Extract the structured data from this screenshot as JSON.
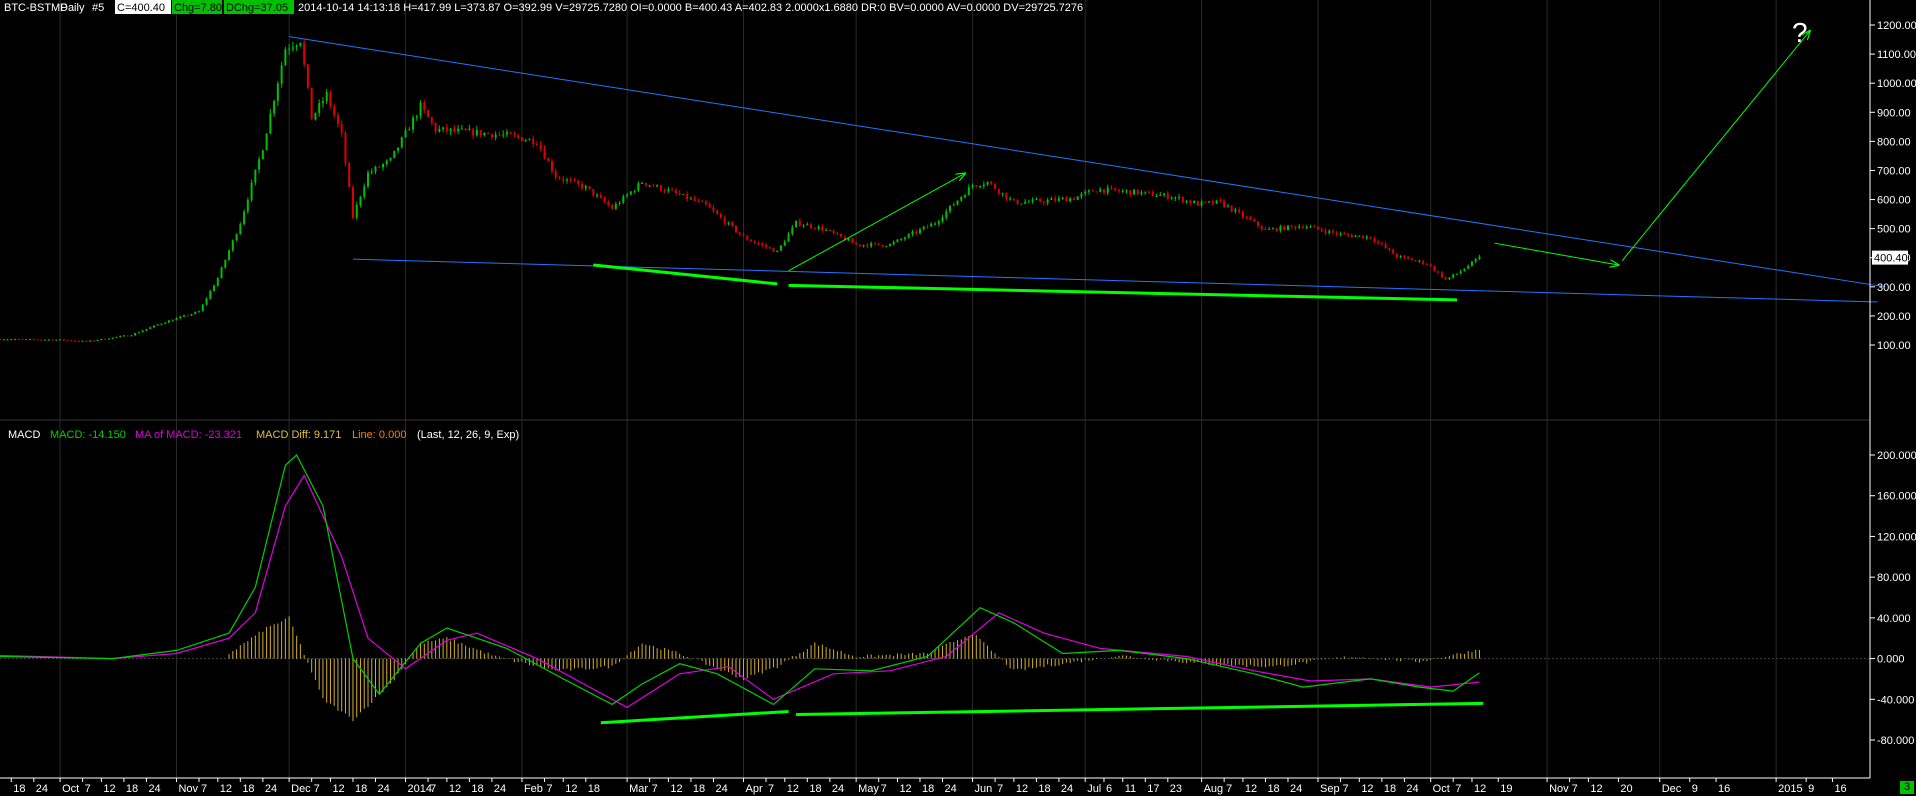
{
  "header": {
    "symbol": "BTC-BSTMP",
    "interval": "Daily",
    "index": "#5",
    "close_box": "C=400.40",
    "chg_box": "Chg=7.80",
    "dchg_box": "DChg=37.05",
    "stats": "2014-10-14 14:13:18 H=417.99 L=373.87 O=392.99 V=29725.7280 OI=0.0000 B=400.43 A=402.83 2.0000x1.6880 DR:0 BV=0.0000 AV=0.0000 DV=29725.7276"
  },
  "macd_header": {
    "label": "MACD",
    "macd": "MACD: -14.150",
    "ma": "MA of MACD: -23.321",
    "diff": "MACD Diff: 9.171",
    "line": "Line: 0.000",
    "params": "(Last, 12, 26, 9, Exp)"
  },
  "annotation": {
    "question_mark": "?"
  },
  "corner_badge": "3",
  "colors": {
    "background": "#000000",
    "up_candle": "#00c000",
    "down_candle": "#e00000",
    "trendline": "#1e78ff",
    "annotation": "#00ff00",
    "macd_line": "#00d000",
    "signal_line": "#e000e0",
    "histogram": "#d4b020",
    "grid": "#2a2a2a",
    "axis_text": "#ffffff",
    "last_price_box": "#ffffff"
  },
  "chart_data": [
    {
      "type": "candlestick",
      "name": "BTC-BSTMP",
      "last_price_label": "400.40",
      "y_axis": {
        "ticks": [
          "1200.00",
          "1100.00",
          "1000.00",
          "900.00",
          "800.00",
          "700.00",
          "600.00",
          "500.00",
          "400.00",
          "300.00",
          "200.00",
          "100.00"
        ],
        "tick_values": [
          1200,
          1100,
          1000,
          900,
          800,
          700,
          600,
          500,
          400,
          300,
          200,
          100
        ],
        "range": [
          80,
          1240
        ]
      },
      "price_path": [
        [
          "2013-09-15",
          120
        ],
        [
          "2013-10-01",
          118
        ],
        [
          "2013-10-08",
          112
        ],
        [
          "2013-10-20",
          135
        ],
        [
          "2013-10-28",
          175
        ],
        [
          "2013-11-07",
          215
        ],
        [
          "2013-11-12",
          330
        ],
        [
          "2013-11-18",
          520
        ],
        [
          "2013-11-24",
          780
        ],
        [
          "2013-11-30",
          1120
        ],
        [
          "2013-12-04",
          1150
        ],
        [
          "2013-12-07",
          880
        ],
        [
          "2013-12-11",
          960
        ],
        [
          "2013-12-15",
          820
        ],
        [
          "2013-12-18",
          540
        ],
        [
          "2013-12-22",
          690
        ],
        [
          "2013-12-28",
          735
        ],
        [
          "2014-01-05",
          920
        ],
        [
          "2014-01-09",
          840
        ],
        [
          "2014-01-20",
          830
        ],
        [
          "2014-01-28",
          820
        ],
        [
          "2014-02-05",
          800
        ],
        [
          "2014-02-10",
          680
        ],
        [
          "2014-02-18",
          640
        ],
        [
          "2014-02-25",
          570
        ],
        [
          "2014-03-05",
          660
        ],
        [
          "2014-03-12",
          630
        ],
        [
          "2014-03-22",
          580
        ],
        [
          "2014-04-01",
          470
        ],
        [
          "2014-04-10",
          420
        ],
        [
          "2014-04-15",
          520
        ],
        [
          "2014-04-22",
          500
        ],
        [
          "2014-05-01",
          445
        ],
        [
          "2014-05-10",
          445
        ],
        [
          "2014-05-22",
          520
        ],
        [
          "2014-06-01",
          650
        ],
        [
          "2014-06-05",
          660
        ],
        [
          "2014-06-12",
          590
        ],
        [
          "2014-06-20",
          595
        ],
        [
          "2014-06-28",
          605
        ],
        [
          "2014-07-04",
          635
        ],
        [
          "2014-07-14",
          625
        ],
        [
          "2014-07-24",
          610
        ],
        [
          "2014-07-31",
          585
        ],
        [
          "2014-08-06",
          590
        ],
        [
          "2014-08-18",
          495
        ],
        [
          "2014-08-28",
          510
        ],
        [
          "2014-09-07",
          480
        ],
        [
          "2014-09-15",
          470
        ],
        [
          "2014-09-22",
          405
        ],
        [
          "2014-09-30",
          380
        ],
        [
          "2014-10-05",
          325
        ],
        [
          "2014-10-08",
          345
        ],
        [
          "2014-10-14",
          400
        ]
      ]
    },
    {
      "type": "line",
      "name": "MACD",
      "y_axis": {
        "ticks": [
          "200.000",
          "160.000",
          "120.000",
          "80.000",
          "40.000",
          "0.000",
          "-40.000",
          "-80.000"
        ],
        "tick_values": [
          200,
          160,
          120,
          80,
          40,
          0,
          -40,
          -80
        ],
        "range": [
          -100,
          205
        ]
      },
      "series": [
        {
          "name": "MACD",
          "points": [
            [
              "2013-09-15",
              2
            ],
            [
              "2013-10-15",
              0
            ],
            [
              "2013-11-01",
              8
            ],
            [
              "2013-11-15",
              25
            ],
            [
              "2013-11-22",
              70
            ],
            [
              "2013-11-30",
              190
            ],
            [
              "2013-12-03",
              200
            ],
            [
              "2013-12-10",
              150
            ],
            [
              "2013-12-18",
              0
            ],
            [
              "2013-12-25",
              -35
            ],
            [
              "2014-01-05",
              15
            ],
            [
              "2014-01-12",
              30
            ],
            [
              "2014-01-28",
              10
            ],
            [
              "2014-02-12",
              -20
            ],
            [
              "2014-02-25",
              -45
            ],
            [
              "2014-03-05",
              -25
            ],
            [
              "2014-03-15",
              -5
            ],
            [
              "2014-03-25",
              -15
            ],
            [
              "2014-04-09",
              -45
            ],
            [
              "2014-04-20",
              -10
            ],
            [
              "2014-05-05",
              -12
            ],
            [
              "2014-05-20",
              2
            ],
            [
              "2014-06-03",
              50
            ],
            [
              "2014-06-12",
              35
            ],
            [
              "2014-06-25",
              5
            ],
            [
              "2014-07-10",
              8
            ],
            [
              "2014-07-28",
              0
            ],
            [
              "2014-08-15",
              -15
            ],
            [
              "2014-08-28",
              -28
            ],
            [
              "2014-09-15",
              -20
            ],
            [
              "2014-09-28",
              -28
            ],
            [
              "2014-10-07",
              -32
            ],
            [
              "2014-10-14",
              -14
            ]
          ]
        },
        {
          "name": "MA of MACD",
          "points": [
            [
              "2013-09-15",
              3
            ],
            [
              "2013-10-15",
              0
            ],
            [
              "2013-11-01",
              5
            ],
            [
              "2013-11-15",
              20
            ],
            [
              "2013-11-22",
              45
            ],
            [
              "2013-11-30",
              150
            ],
            [
              "2013-12-05",
              180
            ],
            [
              "2013-12-15",
              100
            ],
            [
              "2013-12-22",
              20
            ],
            [
              "2014-01-01",
              -10
            ],
            [
              "2014-01-12",
              18
            ],
            [
              "2014-01-20",
              25
            ],
            [
              "2014-02-05",
              0
            ],
            [
              "2014-02-20",
              -30
            ],
            [
              "2014-03-01",
              -48
            ],
            [
              "2014-03-15",
              -15
            ],
            [
              "2014-03-28",
              -8
            ],
            [
              "2014-04-09",
              -40
            ],
            [
              "2014-04-25",
              -15
            ],
            [
              "2014-05-10",
              -12
            ],
            [
              "2014-05-25",
              2
            ],
            [
              "2014-06-08",
              45
            ],
            [
              "2014-06-20",
              25
            ],
            [
              "2014-07-05",
              10
            ],
            [
              "2014-07-28",
              2
            ],
            [
              "2014-08-15",
              -12
            ],
            [
              "2014-08-30",
              -22
            ],
            [
              "2014-09-15",
              -20
            ],
            [
              "2014-10-01",
              -28
            ],
            [
              "2014-10-14",
              -23
            ]
          ]
        },
        {
          "name": "MACD Diff",
          "type": "histogram",
          "points": [
            [
              "2013-11-15",
              5
            ],
            [
              "2013-11-25",
              30
            ],
            [
              "2013-12-01",
              40
            ],
            [
              "2013-12-10",
              -40
            ],
            [
              "2013-12-18",
              -60
            ],
            [
              "2013-12-28",
              -25
            ],
            [
              "2014-01-05",
              15
            ],
            [
              "2014-01-12",
              20
            ],
            [
              "2014-01-25",
              2
            ],
            [
              "2014-02-10",
              -12
            ],
            [
              "2014-02-25",
              -8
            ],
            [
              "2014-03-05",
              15
            ],
            [
              "2014-03-15",
              5
            ],
            [
              "2014-04-01",
              -20
            ],
            [
              "2014-04-10",
              -8
            ],
            [
              "2014-04-20",
              15
            ],
            [
              "2014-05-01",
              2
            ],
            [
              "2014-05-20",
              5
            ],
            [
              "2014-06-01",
              25
            ],
            [
              "2014-06-12",
              -12
            ],
            [
              "2014-06-25",
              -5
            ],
            [
              "2014-07-10",
              3
            ],
            [
              "2014-08-01",
              -5
            ],
            [
              "2014-08-20",
              -8
            ],
            [
              "2014-09-10",
              2
            ],
            [
              "2014-09-28",
              -3
            ],
            [
              "2014-10-14",
              9
            ]
          ]
        }
      ]
    }
  ],
  "x_axis": {
    "labels": [
      {
        "t": "18",
        "d": "2013-09-18"
      },
      {
        "t": "24",
        "d": "2013-09-24"
      },
      {
        "t": "Oct",
        "d": "2013-10-01",
        "month": true
      },
      {
        "t": "7",
        "d": "2013-10-07"
      },
      {
        "t": "12",
        "d": "2013-10-12"
      },
      {
        "t": "18",
        "d": "2013-10-18"
      },
      {
        "t": "24",
        "d": "2013-10-24"
      },
      {
        "t": "Nov",
        "d": "2013-11-01",
        "month": true
      },
      {
        "t": "7",
        "d": "2013-11-07"
      },
      {
        "t": "12",
        "d": "2013-11-12"
      },
      {
        "t": "18",
        "d": "2013-11-18"
      },
      {
        "t": "24",
        "d": "2013-11-24"
      },
      {
        "t": "Dec",
        "d": "2013-12-01",
        "month": true
      },
      {
        "t": "7",
        "d": "2013-12-07"
      },
      {
        "t": "12",
        "d": "2013-12-12"
      },
      {
        "t": "18",
        "d": "2013-12-18"
      },
      {
        "t": "24",
        "d": "2013-12-24"
      },
      {
        "t": "2014",
        "d": "2014-01-01",
        "month": true
      },
      {
        "t": "7",
        "d": "2014-01-07"
      },
      {
        "t": "12",
        "d": "2014-01-12"
      },
      {
        "t": "18",
        "d": "2014-01-18"
      },
      {
        "t": "24",
        "d": "2014-01-24"
      },
      {
        "t": "Feb",
        "d": "2014-02-01",
        "month": true
      },
      {
        "t": "7",
        "d": "2014-02-07"
      },
      {
        "t": "12",
        "d": "2014-02-12"
      },
      {
        "t": "18",
        "d": "2014-02-18"
      },
      {
        "t": "Mar",
        "d": "2014-03-01",
        "month": true
      },
      {
        "t": "7",
        "d": "2014-03-07"
      },
      {
        "t": "12",
        "d": "2014-03-12"
      },
      {
        "t": "18",
        "d": "2014-03-18"
      },
      {
        "t": "24",
        "d": "2014-03-24"
      },
      {
        "t": "Apr",
        "d": "2014-04-01",
        "month": true
      },
      {
        "t": "7",
        "d": "2014-04-07"
      },
      {
        "t": "12",
        "d": "2014-04-12"
      },
      {
        "t": "18",
        "d": "2014-04-18"
      },
      {
        "t": "24",
        "d": "2014-04-24"
      },
      {
        "t": "May",
        "d": "2014-05-01",
        "month": true
      },
      {
        "t": "7",
        "d": "2014-05-07"
      },
      {
        "t": "12",
        "d": "2014-05-12"
      },
      {
        "t": "18",
        "d": "2014-05-18"
      },
      {
        "t": "24",
        "d": "2014-05-24"
      },
      {
        "t": "Jun",
        "d": "2014-06-01",
        "month": true
      },
      {
        "t": "7",
        "d": "2014-06-07"
      },
      {
        "t": "12",
        "d": "2014-06-12"
      },
      {
        "t": "18",
        "d": "2014-06-18"
      },
      {
        "t": "24",
        "d": "2014-06-24"
      },
      {
        "t": "Jul",
        "d": "2014-07-01",
        "month": true
      },
      {
        "t": "6",
        "d": "2014-07-06"
      },
      {
        "t": "11",
        "d": "2014-07-11"
      },
      {
        "t": "17",
        "d": "2014-07-17"
      },
      {
        "t": "23",
        "d": "2014-07-23"
      },
      {
        "t": "Aug",
        "d": "2014-08-01",
        "month": true
      },
      {
        "t": "7",
        "d": "2014-08-07"
      },
      {
        "t": "12",
        "d": "2014-08-12"
      },
      {
        "t": "18",
        "d": "2014-08-18"
      },
      {
        "t": "24",
        "d": "2014-08-24"
      },
      {
        "t": "Sep",
        "d": "2014-09-01",
        "month": true
      },
      {
        "t": "7",
        "d": "2014-09-07"
      },
      {
        "t": "12",
        "d": "2014-09-12"
      },
      {
        "t": "18",
        "d": "2014-09-18"
      },
      {
        "t": "24",
        "d": "2014-09-24"
      },
      {
        "t": "Oct",
        "d": "2014-10-01",
        "month": true
      },
      {
        "t": "7",
        "d": "2014-10-07"
      },
      {
        "t": "12",
        "d": "2014-10-12"
      },
      {
        "t": "19",
        "d": "2014-10-19"
      },
      {
        "t": "Nov",
        "d": "2014-11-01",
        "month": true
      },
      {
        "t": "7",
        "d": "2014-11-07"
      },
      {
        "t": "12",
        "d": "2014-11-12"
      },
      {
        "t": "20",
        "d": "2014-11-20"
      },
      {
        "t": "Dec",
        "d": "2014-12-01",
        "month": true
      },
      {
        "t": "9",
        "d": "2014-12-09"
      },
      {
        "t": "16",
        "d": "2014-12-16"
      },
      {
        "t": "2015",
        "d": "2015-01-01",
        "month": true
      },
      {
        "t": "9",
        "d": "2015-01-09"
      },
      {
        "t": "16",
        "d": "2015-01-16"
      }
    ]
  },
  "trendlines": [
    {
      "name": "upper-resistance",
      "from": [
        "2013-12-01",
        1160
      ],
      "to": [
        "2015-01-30",
        300
      ]
    },
    {
      "name": "lower-support",
      "from": [
        "2013-12-18",
        395
      ],
      "to": [
        "2015-01-28",
        248
      ]
    }
  ],
  "annotations": [
    {
      "name": "price-arrow-1",
      "from": [
        "2014-04-13",
        355
      ],
      "to": [
        "2014-05-30",
        690
      ],
      "arrow": true
    },
    {
      "name": "price-arrow-2",
      "from": [
        "2014-10-18",
        450
      ],
      "to": [
        "2014-11-20",
        375
      ],
      "arrow": true
    },
    {
      "name": "price-arrow-3",
      "from": [
        "2014-11-21",
        390
      ],
      "to": [
        "2015-01-10",
        1180
      ],
      "arrow": true
    },
    {
      "name": "price-support-1",
      "from": [
        "2014-02-20",
        375
      ],
      "to": [
        "2014-04-10",
        310
      ],
      "thick": true
    },
    {
      "name": "price-support-2",
      "from": [
        "2014-04-13",
        305
      ],
      "to": [
        "2014-10-08",
        255
      ],
      "thick": true
    },
    {
      "name": "macd-support-1",
      "from": [
        "2014-02-22",
        -63
      ],
      "to": [
        "2014-04-13",
        -52
      ],
      "thick": true,
      "panel": "macd"
    },
    {
      "name": "macd-support-2",
      "from": [
        "2014-04-15",
        -55
      ],
      "to": [
        "2014-10-15",
        -44
      ],
      "thick": true,
      "panel": "macd"
    }
  ]
}
